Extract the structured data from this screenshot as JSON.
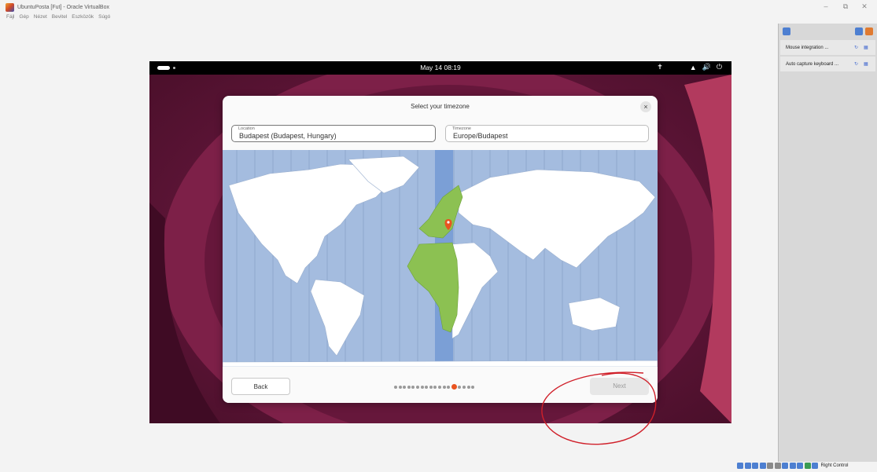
{
  "window": {
    "title": "UbuntuPosta [Fut] - Oracle VirtualBox",
    "controls": {
      "minimize": "–",
      "restore": "⧉",
      "close": "✕"
    },
    "menu": [
      "Fájl",
      "Gép",
      "Nézet",
      "Bevitel",
      "Eszközök",
      "Súgó"
    ]
  },
  "ubuntu_topbar": {
    "clock": "May 14 08:19",
    "tray_icons": [
      "accessibility-icon",
      "network-icon",
      "volume-icon",
      "power-icon"
    ]
  },
  "installer": {
    "title": "Select your timezone",
    "close_glyph": "×",
    "location": {
      "label": "Location",
      "value": "Budapest (Budapest, Hungary)"
    },
    "timezone": {
      "label": "Timezone",
      "value": "Europe/Budapest"
    },
    "back_label": "Back",
    "next_label": "Next",
    "pager": {
      "total": 18,
      "current": 14
    }
  },
  "side_panel": {
    "items": [
      {
        "label": "Mouse integration ..."
      },
      {
        "label": "Auto capture keyboard ..."
      }
    ]
  },
  "status_bar": {
    "host_key": "Right Control"
  },
  "colors": {
    "accent": "#e95420",
    "highlight_zone": "#7b9fd6",
    "selected_region": "#8cc152",
    "map_ocean": "#a4bcdf",
    "annotation": "#d0202a"
  }
}
